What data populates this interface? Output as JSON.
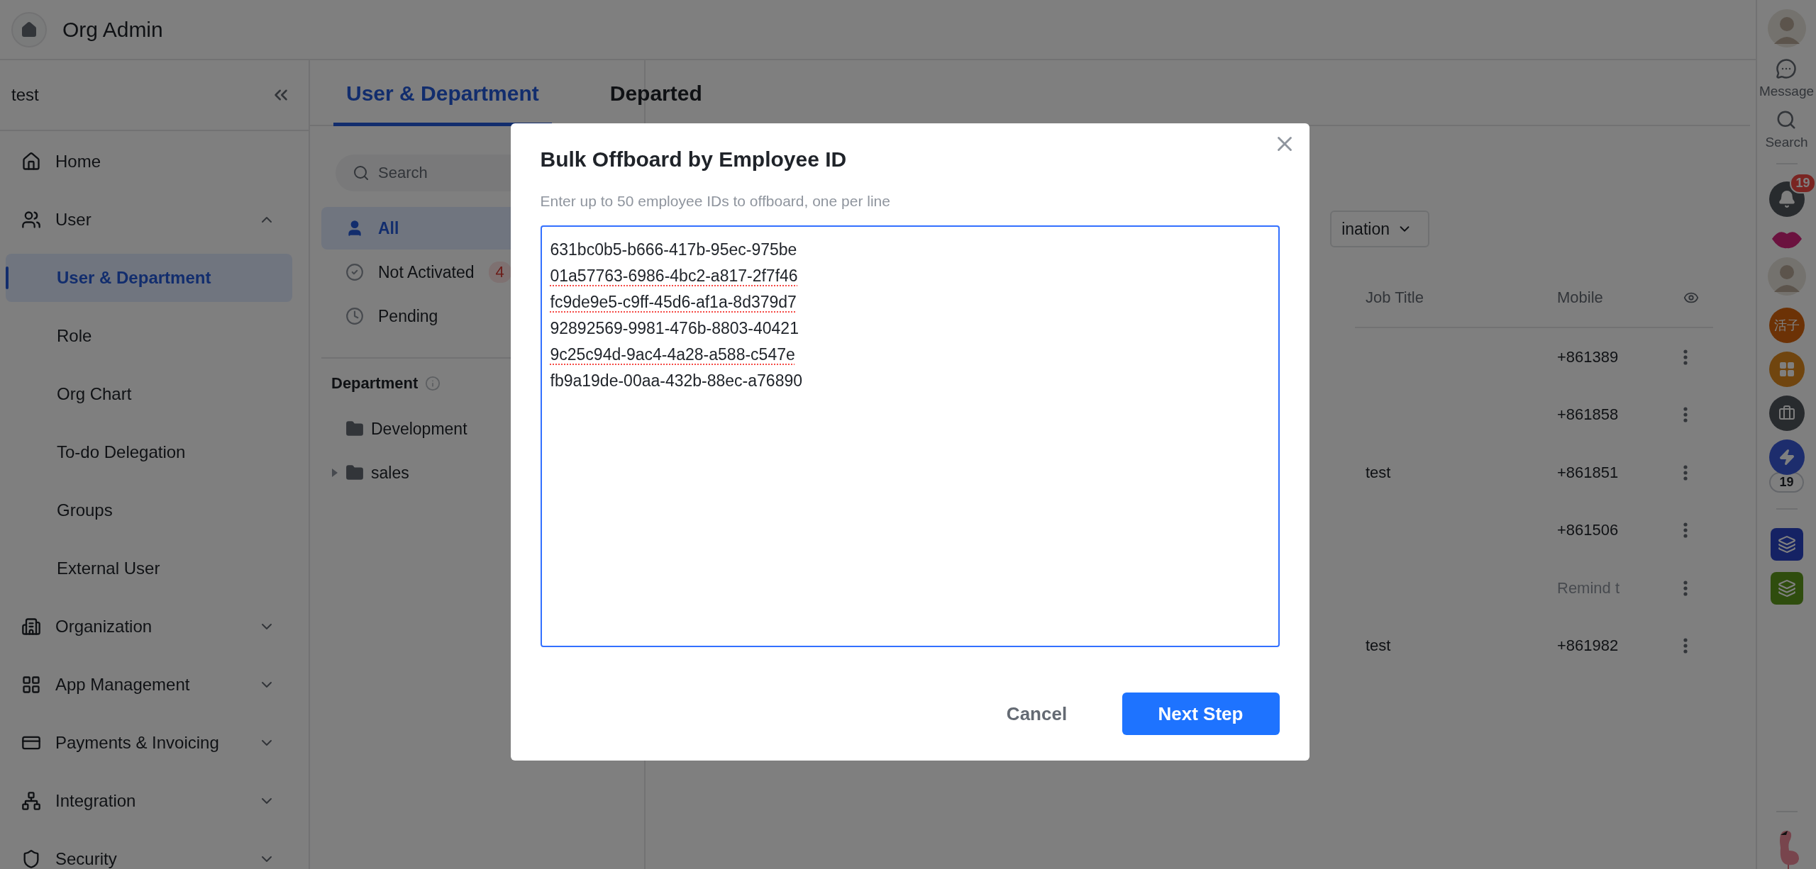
{
  "app": {
    "title": "Org Admin"
  },
  "sidebar": {
    "org": "test",
    "items": [
      {
        "label": "Home",
        "kind": "link",
        "selected": false
      },
      {
        "label": "User",
        "kind": "group",
        "selected": false,
        "expanded": true,
        "children": [
          {
            "label": "User & Department",
            "selected": true
          },
          {
            "label": "Role",
            "selected": false
          },
          {
            "label": "Org Chart",
            "selected": false
          },
          {
            "label": "To-do Delegation",
            "selected": false
          },
          {
            "label": "Groups",
            "selected": false
          },
          {
            "label": "External User",
            "selected": false
          }
        ]
      },
      {
        "label": "Organization",
        "kind": "group",
        "selected": false,
        "expanded": false
      },
      {
        "label": "App Management",
        "kind": "group",
        "selected": false,
        "expanded": false
      },
      {
        "label": "Payments & Invoicing",
        "kind": "group",
        "selected": false,
        "expanded": false
      },
      {
        "label": "Integration",
        "kind": "group",
        "selected": false,
        "expanded": false
      },
      {
        "label": "Security",
        "kind": "group",
        "selected": false,
        "expanded": false
      }
    ]
  },
  "tabs": [
    {
      "label": "User & Department",
      "selected": true
    },
    {
      "label": "Departed",
      "selected": false
    }
  ],
  "search": {
    "placeholder": "Search"
  },
  "filters": [
    {
      "label": "All",
      "selected": true
    },
    {
      "label": "Not Activated",
      "count": "4",
      "selected": false
    },
    {
      "label": "Pending",
      "selected": false
    }
  ],
  "department": {
    "title": "Department",
    "tree": [
      {
        "label": "Development",
        "has_children": false
      },
      {
        "label": "sales",
        "has_children": true,
        "expanded": false
      }
    ]
  },
  "filter_button": {
    "label": "ination"
  },
  "table": {
    "columns": [
      {
        "label": "Job Title"
      },
      {
        "label": "Mobile"
      }
    ],
    "rows": [
      {
        "kind": "phone",
        "mobile": "+861389"
      },
      {
        "kind": "phone",
        "mobile": "+861858"
      },
      {
        "kind": "phone",
        "job_title": "test",
        "mobile": "+861851"
      },
      {
        "kind": "phone",
        "mobile": "+861506"
      },
      {
        "kind": "remind",
        "mobile": "Remind t"
      },
      {
        "kind": "phone",
        "job_title": "test",
        "mobile": "+861982"
      }
    ]
  },
  "dock": {
    "buttons": [
      {
        "label": "Message"
      },
      {
        "label": "Search"
      }
    ],
    "notification_badge": "19",
    "workspace_initials": "活子",
    "bolt_count": "19"
  },
  "modal": {
    "title": "Bulk Offboard by Employee ID",
    "hint": "Enter up to 50 employee IDs to offboard, one per line",
    "lines": [
      {
        "text": "631bc0b5-b666-417b-95ec-975be",
        "misspelled": false
      },
      {
        "text": "01a57763-6986-4bc2-a817-2f7f46",
        "misspelled": true
      },
      {
        "text": "fc9de9e5-c9ff-45d6-af1a-8d379d7",
        "misspelled": true
      },
      {
        "text": "92892569-9981-476b-8803-40421",
        "misspelled": false
      },
      {
        "text": "9c25c94d-9ac4-4a28-a588-c547e",
        "misspelled": true
      },
      {
        "text": "fb9a19de-00aa-432b-88ec-a76890",
        "misspelled": false
      }
    ],
    "buttons": [
      {
        "label": "Cancel",
        "kind": "secondary"
      },
      {
        "label": "Next Step",
        "kind": "primary"
      }
    ]
  }
}
